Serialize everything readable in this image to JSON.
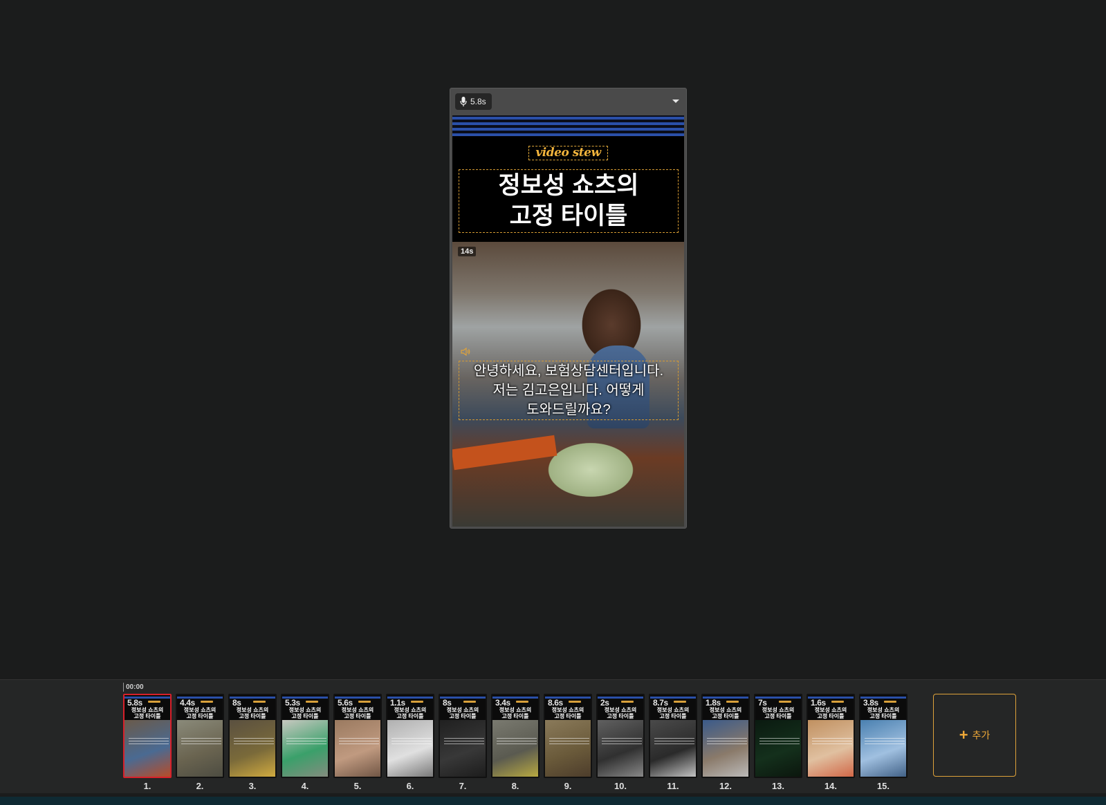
{
  "preview": {
    "voice_duration": "5.8s",
    "brand_logo": "video stew",
    "title": "정보성 쇼츠의\n고정 타이틀",
    "clip_duration": "14s",
    "subtitle": "안녕하세요, 보험상담센터입니다.\n저는 김고은입니다. 어떻게\n도와드릴까요?"
  },
  "timeline": {
    "time_label": "00:00",
    "add_label": "추가",
    "thumb_title": "정보성 쇼츠의\n고정 타이틀",
    "scenes": [
      {
        "num": "1.",
        "duration": "5.8s",
        "selected": true,
        "colors": [
          "#6a5a4a",
          "#4a6a92",
          "#c04a20"
        ]
      },
      {
        "num": "2.",
        "duration": "4.4s",
        "colors": [
          "#8a8a7a",
          "#6a6450",
          "#4a4a40"
        ]
      },
      {
        "num": "3.",
        "duration": "8s",
        "colors": [
          "#5a5040",
          "#7a6a3a",
          "#d8b040"
        ]
      },
      {
        "num": "4.",
        "duration": "5.3s",
        "colors": [
          "#c8c8c0",
          "#3aa06a",
          "#8a8a80"
        ]
      },
      {
        "num": "5.",
        "duration": "5.6s",
        "colors": [
          "#9a7a60",
          "#c09a80",
          "#6a5040"
        ]
      },
      {
        "num": "6.",
        "duration": "1.1s",
        "colors": [
          "#b0b0b0",
          "#e0e0e0",
          "#707070"
        ]
      },
      {
        "num": "7.",
        "duration": "8s",
        "colors": [
          "#202020",
          "#383838",
          "#1a1a1a"
        ]
      },
      {
        "num": "8.",
        "duration": "3.4s",
        "colors": [
          "#7a7a70",
          "#5a5a50",
          "#c0b040"
        ]
      },
      {
        "num": "9.",
        "duration": "8.6s",
        "colors": [
          "#8a7a5a",
          "#6a5a3a",
          "#4a3a2a"
        ]
      },
      {
        "num": "10.",
        "duration": "2s",
        "colors": [
          "#606060",
          "#303030",
          "#909090"
        ]
      },
      {
        "num": "11.",
        "duration": "8.7s",
        "colors": [
          "#4a4a4a",
          "#2a2a2a",
          "#d0d0d0"
        ]
      },
      {
        "num": "12.",
        "duration": "1.8s",
        "colors": [
          "#3a5a8a",
          "#8a7a6a",
          "#c0c0c0"
        ]
      },
      {
        "num": "13.",
        "duration": "7s",
        "colors": [
          "#0a1a10",
          "#14301c",
          "#0a140c"
        ]
      },
      {
        "num": "14.",
        "duration": "1.6s",
        "colors": [
          "#c09060",
          "#e0c0a0",
          "#d06040"
        ]
      },
      {
        "num": "15.",
        "duration": "3.8s",
        "colors": [
          "#4a80b0",
          "#a0c0e0",
          "#3a5a80"
        ]
      }
    ]
  }
}
